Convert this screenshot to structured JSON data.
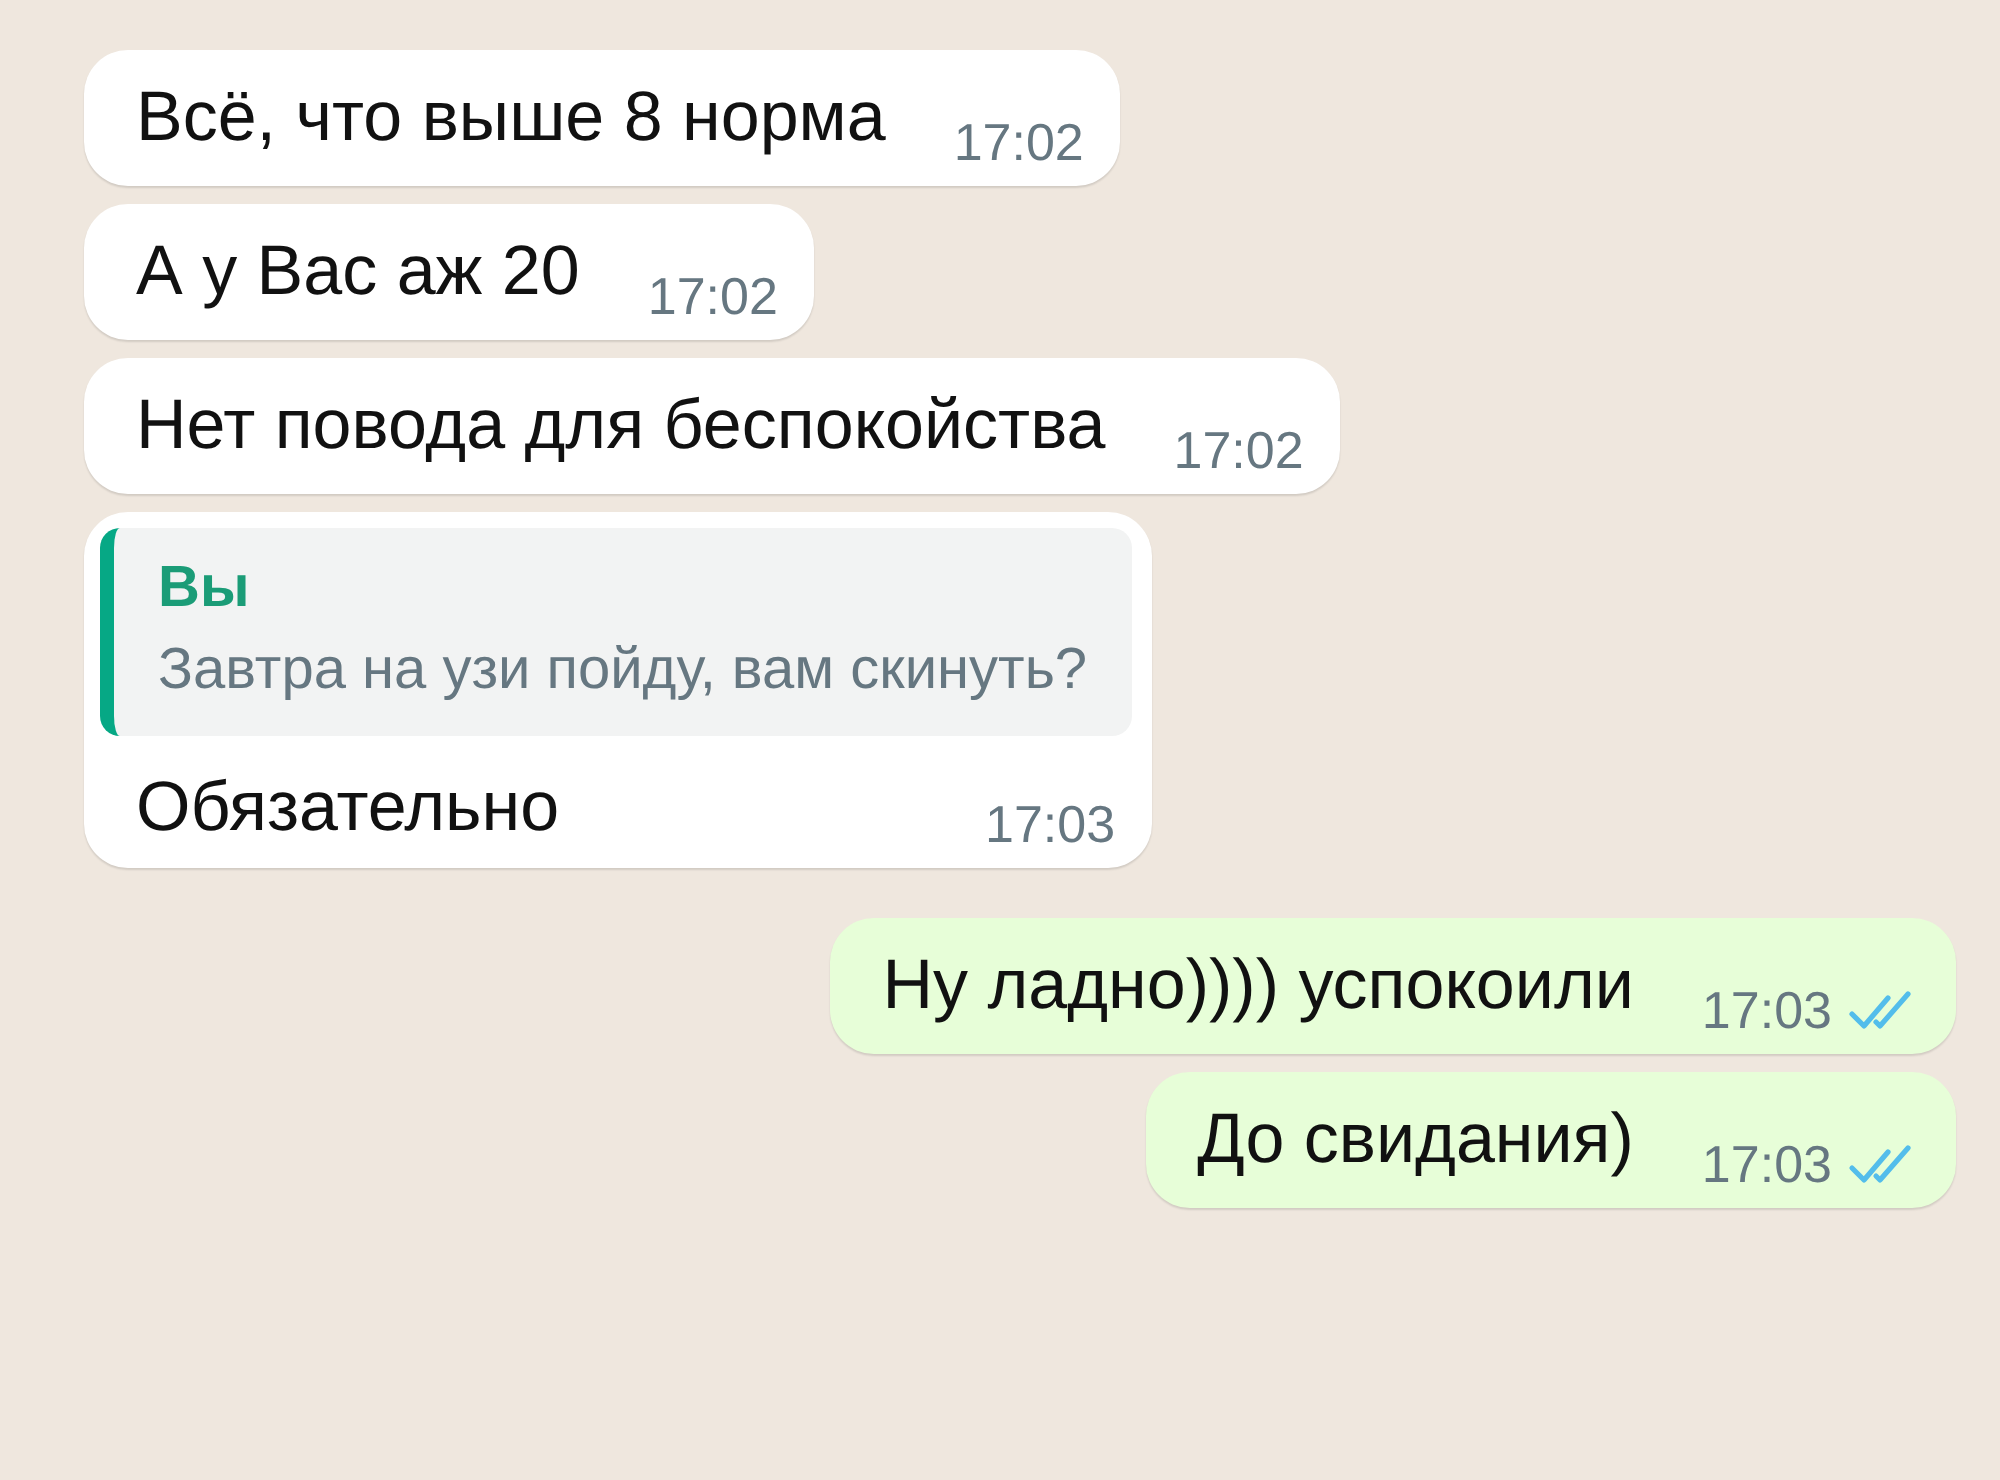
{
  "messages": [
    {
      "kind": "incoming",
      "text": "Всё, что выше 8 норма",
      "time": "17:02"
    },
    {
      "kind": "incoming",
      "text": "А у Вас аж 20",
      "time": "17:02"
    },
    {
      "kind": "incoming",
      "text": "Нет повода для беспокойства",
      "time": "17:02"
    },
    {
      "kind": "incoming",
      "reply": {
        "author": "Вы",
        "text": "Завтра на узи пойду, вам скинуть?"
      },
      "text": "Обязательно",
      "time": "17:03"
    },
    {
      "kind": "outgoing",
      "text": "Ну ладно)))) успокоили",
      "time": "17:03",
      "read": true
    },
    {
      "kind": "outgoing",
      "text": "До свидания)",
      "time": "17:03",
      "read": true
    }
  ]
}
